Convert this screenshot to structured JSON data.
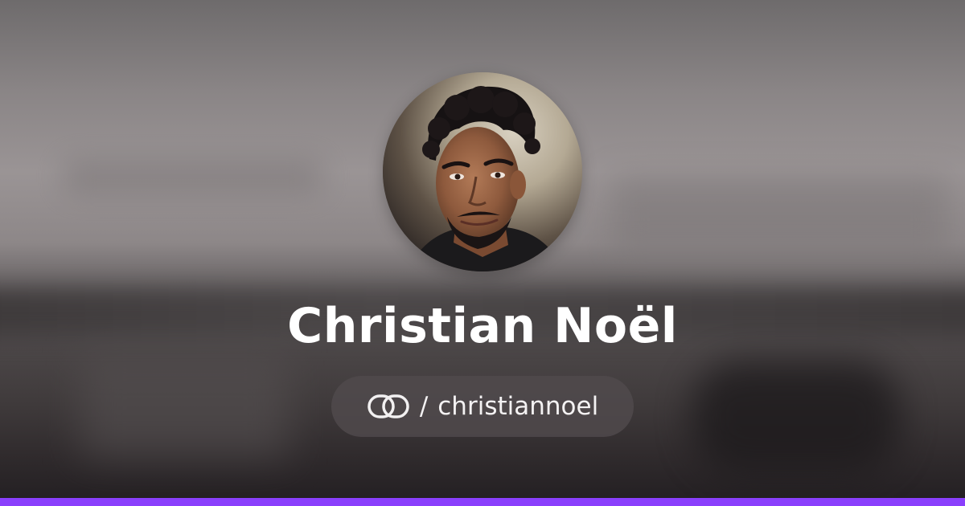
{
  "profile": {
    "name": "Christian Noël",
    "separator": "/",
    "handle": "christiannoel"
  },
  "icons": {
    "avatar": "avatar-photo",
    "logo": "linked-rings-logo-icon"
  },
  "colors": {
    "accent": "#8a3ffc",
    "text": "#ffffff",
    "pill_background": "#504b4d"
  }
}
